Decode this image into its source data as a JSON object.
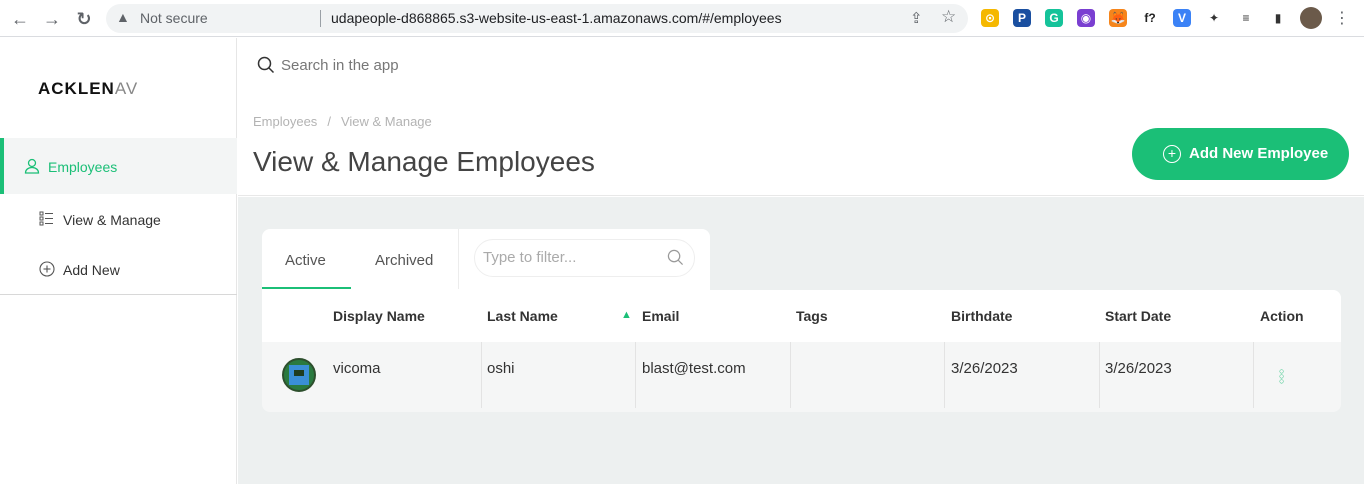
{
  "browser": {
    "security_label": "Not secure",
    "url": "udapeople-d868865.s3-website-us-east-1.amazonaws.com/#/employees",
    "extensions": [
      {
        "icon": "compass-extension-icon",
        "glyph": "⊙",
        "color": "#f5b800"
      },
      {
        "icon": "p-extension-icon",
        "glyph": "P",
        "color": "#1a4fa0"
      },
      {
        "icon": "grammarly-icon",
        "glyph": "G",
        "color": "#15c39a"
      },
      {
        "icon": "color-picker-icon",
        "glyph": "◉",
        "color": "#7a3fd1"
      },
      {
        "icon": "metamask-icon",
        "glyph": "🦊",
        "color": "#f6851b"
      },
      {
        "icon": "font-finder-icon",
        "glyph": "f?",
        "color": "#222222"
      },
      {
        "icon": "shield-v-icon",
        "glyph": "V",
        "color": "#3b82f6"
      },
      {
        "icon": "puzzle-icon",
        "glyph": "✦",
        "color": "#333333"
      },
      {
        "icon": "media-control-icon",
        "glyph": "≡",
        "color": "#333333"
      },
      {
        "icon": "side-panel-icon",
        "glyph": "▮",
        "color": "#333333"
      }
    ]
  },
  "brand": {
    "logo_main": "ACKLEN",
    "logo_fade": "AV",
    "accent": "#1bbf77"
  },
  "sidebar": {
    "active_item": {
      "label": "Employees",
      "icon": "user-icon"
    },
    "sub_items": [
      {
        "label": "View & Manage",
        "icon": "list-icon"
      },
      {
        "label": "Add New",
        "icon": "plus-circle-icon"
      }
    ]
  },
  "search": {
    "placeholder": "Search in the app"
  },
  "breadcrumb": {
    "items": [
      "Employees",
      "View & Manage"
    ]
  },
  "page": {
    "title": "View & Manage Employees",
    "add_button": "Add New Employee"
  },
  "tabs": [
    {
      "label": "Active"
    },
    {
      "label": "Archived"
    }
  ],
  "filter": {
    "placeholder": "Type to filter..."
  },
  "table": {
    "columns": [
      "Display Name",
      "Last Name",
      "Email",
      "Tags",
      "Birthdate",
      "Start Date",
      "Action"
    ],
    "sort_indicator": "▲",
    "rows": [
      {
        "display_name": "vicoma",
        "last_name": "oshi",
        "email": "blast@test.com",
        "tags": "",
        "birthdate": "3/26/2023",
        "start_date": "3/26/2023"
      }
    ]
  }
}
